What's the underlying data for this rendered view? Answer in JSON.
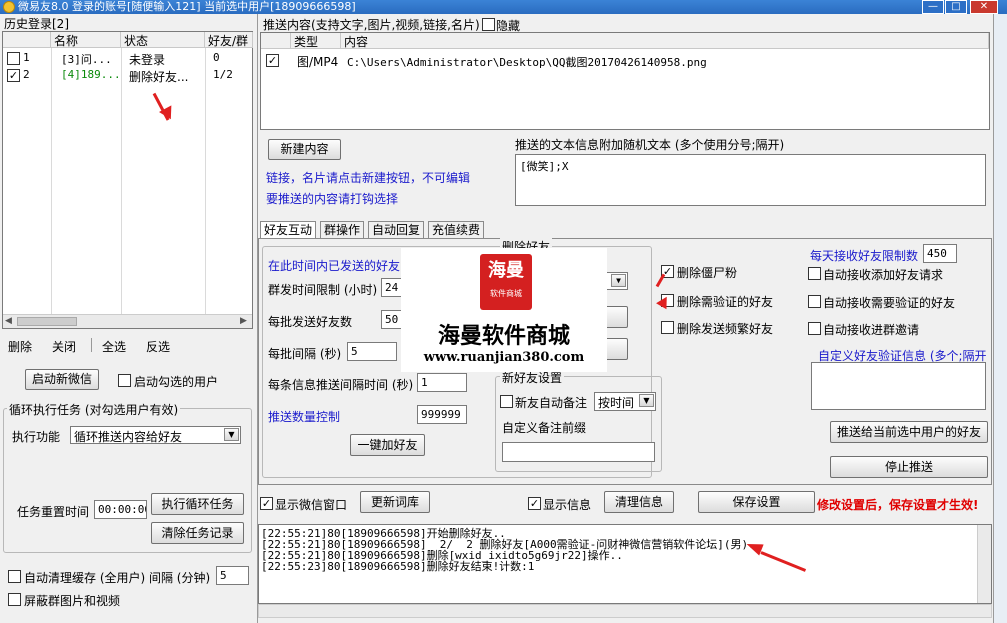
{
  "window": {
    "title": "微易友8.0 登录的账号[随便输入121] 当前选中用户[18909666598]",
    "min": "—",
    "max": "□",
    "close": "✕"
  },
  "history": {
    "title": "历史登录[2]",
    "columns": [
      "名称",
      "状态",
      "好友/群"
    ],
    "rows": [
      {
        "idx": "1",
        "name": "[3]问...",
        "status": "未登录",
        "friends": "0",
        "checked": false
      },
      {
        "idx": "2",
        "name": "[4]189...",
        "status": "删除好友...",
        "friends": "1/2",
        "checked": true
      }
    ],
    "actions": [
      "删除",
      "关闭",
      "全选",
      "反选"
    ],
    "start_button": "启动新微信",
    "start_checked_label": "启动勾选的用户"
  },
  "loop": {
    "title": "循环执行任务 (对勾选用户有效)",
    "func_label": "执行功能",
    "func_value": "循环推送内容给好友",
    "reset_label": "任务重置时间",
    "reset_value": "00:00:00",
    "exec_button": "执行循环任务",
    "clear_button": "清除任务记录"
  },
  "bottom_left": {
    "auto_clean_label": "自动清理缓存 (全用户) 间隔 (分钟)",
    "auto_clean_value": "5",
    "block_label": "屏蔽群图片和视频"
  },
  "push": {
    "title": "推送内容(支持文字,图片,视频,链接,名片)",
    "hide_label": "隐藏",
    "columns": [
      "类型",
      "内容"
    ],
    "rows": [
      {
        "type": "图/MP4",
        "content": "C:\\Users\\Administrator\\Desktop\\QQ截图20170426140958.png",
        "checked": true
      }
    ],
    "new_button": "新建内容",
    "hint1": "链接，名片请点击新建按钮，不可编辑",
    "hint2": "要推送的内容请打钩选择",
    "random_label": "推送的文本信息附加随机文本 (多个使用分号;隔开)",
    "random_value": "[微笑];X"
  },
  "tabs": [
    "好友互动",
    "群操作",
    "自动回复",
    "充值续费"
  ],
  "add": {
    "range_label": "在此时间内已发送的好友",
    "limit_label": "群发时间限制 (小时)",
    "limit_value": "24",
    "batch_label": "每批发送好友数",
    "batch_value": "50",
    "interval_label": "每批间隔 (秒)",
    "interval_value": "5",
    "msg_interval_label": "每条信息推送间隔时间 (秒)",
    "msg_interval_value": "1",
    "count_label": "推送数量控制",
    "count_value": "999999",
    "add_button": "一键加好友"
  },
  "delete": {
    "title": "删除好友",
    "zombie_label": "删除僵尸粉",
    "verify_label": "删除需验证的好友",
    "frequent_label": "删除发送频繁好友"
  },
  "newfriend": {
    "title": "新好友设置",
    "auto_note_label": "新友自动备注",
    "auto_note_value": "按时间",
    "prefix_label": "自定义备注前缀"
  },
  "accept": {
    "daily_label": "每天接收好友限制数",
    "daily_value": "450",
    "auto_accept": "自动接收添加好友请求",
    "auto_verify": "自动接收需要验证的好友",
    "auto_group": "自动接收进群邀请",
    "custom_label": "自定义好友验证信息 (多个;隔开",
    "push_button": "推送给当前选中用户的好友",
    "stop_button": "停止推送"
  },
  "bar": {
    "show_window": "显示微信窗口",
    "refresh": "更新词库",
    "show_info": "显示信息",
    "clear_info": "清理信息",
    "save": "保存设置",
    "warning": "修改设置后，保存设置才生效!"
  },
  "log": [
    "[22:55:21]80[18909666598]开始删除好友..",
    "[22:55:21]80[18909666598]  2/  2 删除好友[A000需验证-问财神微信营销软件论坛](男)..",
    "[22:55:21]80[18909666598]删除[wxid_ixidto5g69jr22]操作..",
    "[22:55:23]80[18909666598]删除好友结束!计数:1"
  ],
  "watermark": {
    "logo": "海曼",
    "logo_sub": "软件商城",
    "name": "海曼软件商城",
    "url": "www.ruanjian380.com"
  },
  "colors": {
    "titlebar": "#2a6cc0",
    "link_blue": "#1a1acc",
    "warning_red": "#e00000",
    "annotation_red": "#e02020"
  }
}
